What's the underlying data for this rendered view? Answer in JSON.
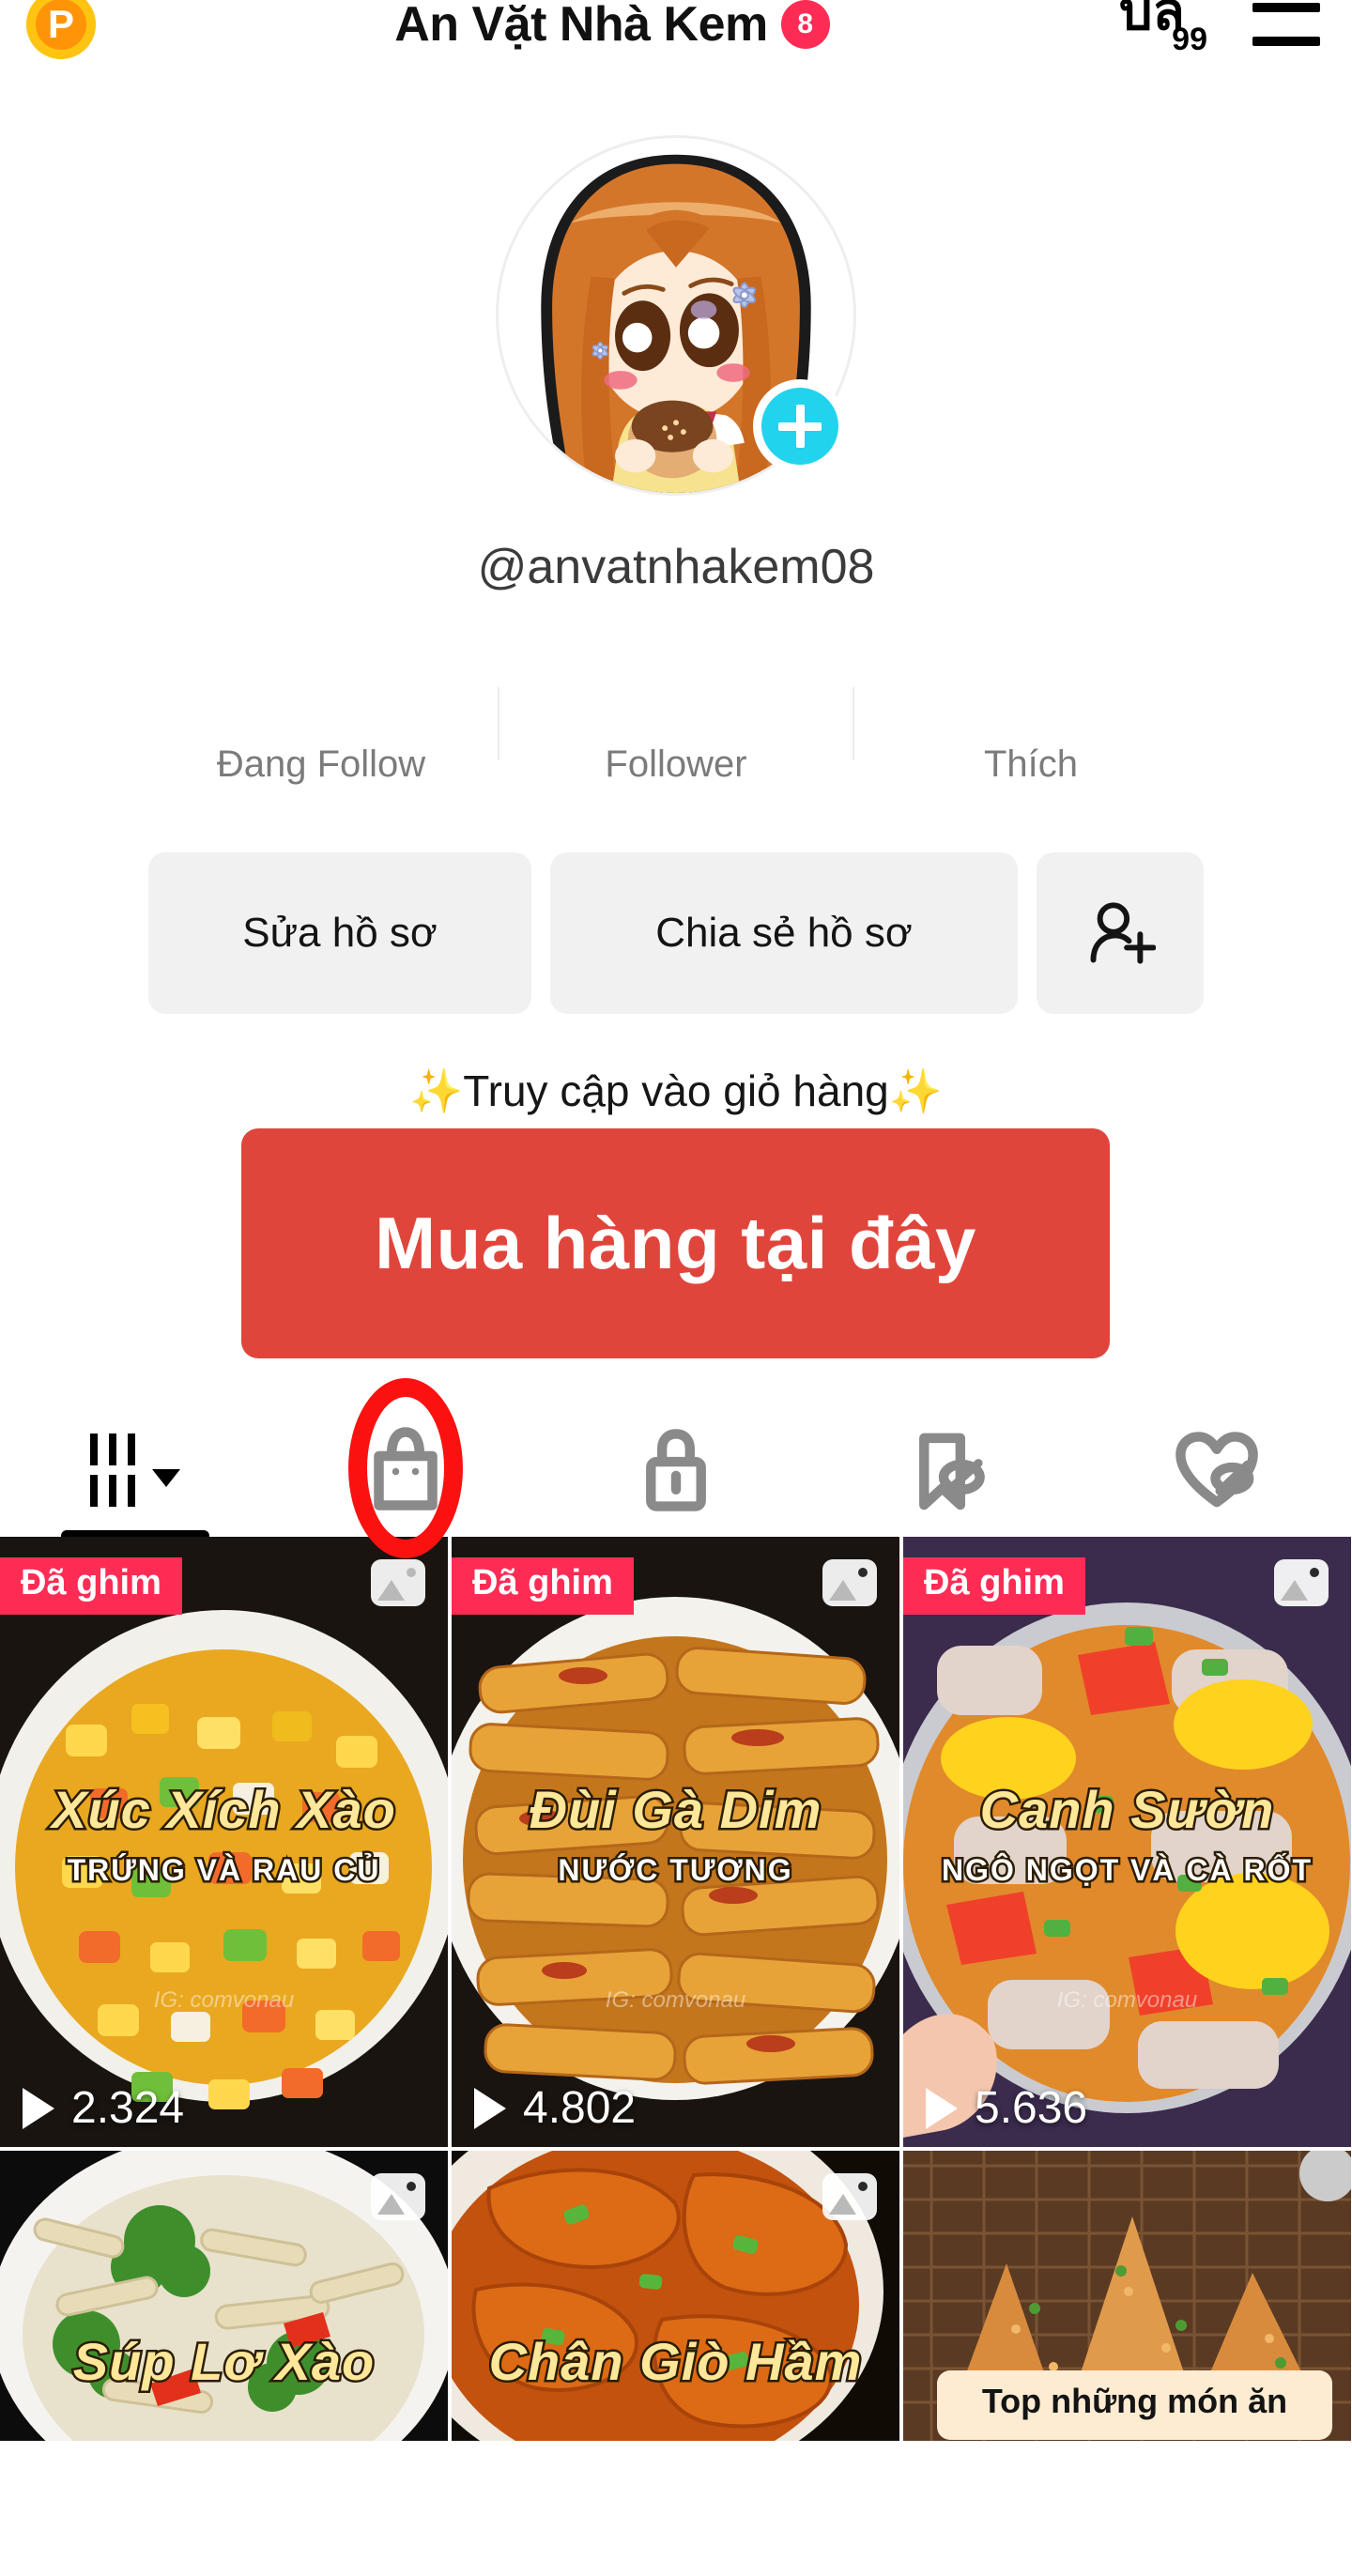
{
  "header": {
    "coin_icon": "coin-p-icon",
    "coin_letter": "P",
    "title": "An Vặt Nhà Kem",
    "title_badge": "8",
    "ads_icon": "ads-manager-icon",
    "ads_glyph": "บล",
    "ads_count": "99",
    "menu_icon": "hamburger-menu-icon"
  },
  "profile": {
    "avatar_alt": "chibi-girl-avatar",
    "follow_button_icon": "plus-icon",
    "handle": "@anvatnhakem08"
  },
  "stats": [
    {
      "value": "",
      "label": "Đang Follow",
      "name": "following"
    },
    {
      "value": "",
      "label": "Follower",
      "name": "followers"
    },
    {
      "value": "",
      "label": "Thích",
      "name": "likes"
    }
  ],
  "actions": {
    "edit_profile": "Sửa hồ sơ",
    "share_profile": "Chia sẻ hồ sơ",
    "add_user_icon": "add-user-icon"
  },
  "bio": {
    "sparkle_left": "✨",
    "text": "Truy cập vào giỏ hàng",
    "sparkle_right": "✨"
  },
  "cta": {
    "label": "Mua hàng tại đây",
    "color": "#e0453c"
  },
  "tabs": [
    {
      "name": "tab-videos",
      "icon": "grid-icon",
      "active": true,
      "has_caret": true
    },
    {
      "name": "tab-shop",
      "icon": "shopping-bag-icon",
      "active": false,
      "highlighted": true
    },
    {
      "name": "tab-private",
      "icon": "lock-icon",
      "active": false
    },
    {
      "name": "tab-saved",
      "icon": "bookmark-hidden-icon",
      "active": false
    },
    {
      "name": "tab-liked",
      "icon": "heart-hidden-icon",
      "active": false
    }
  ],
  "annotation": {
    "shape": "red-oval-highlight",
    "color": "#fc1111",
    "target": "tab-shop"
  },
  "videos": [
    {
      "pin_label": "Đã ghim",
      "multi_icon": "multiple-photos-icon",
      "views": "2.324",
      "overlay_title": "Xúc Xích Xào",
      "overlay_sub": "TRỨNG VÀ RAU CỦ",
      "watermark": "IG: comvonau"
    },
    {
      "pin_label": "Đã ghim",
      "multi_icon": "multiple-photos-icon",
      "views": "4.802",
      "overlay_title": "Đùi Gà Dim",
      "overlay_sub": "NƯỚC TƯƠNG",
      "watermark": "IG: comvonau"
    },
    {
      "pin_label": "Đã ghim",
      "multi_icon": "multiple-photos-icon",
      "views": "5.636",
      "overlay_title": "Canh Sườn",
      "overlay_sub": "NGÔ NGỌT VÀ CÀ RỐT",
      "watermark": "IG: comvonau"
    },
    {
      "pin_label": "",
      "multi_icon": "multiple-photos-icon",
      "views": "",
      "overlay_title": "Súp Lơ Xào",
      "overlay_sub": "",
      "watermark": ""
    },
    {
      "pin_label": "",
      "multi_icon": "multiple-photos-icon",
      "views": "",
      "overlay_title": "Chân Giò Hầm",
      "overlay_sub": "",
      "watermark": ""
    },
    {
      "pin_label": "",
      "multi_icon": "",
      "views": "",
      "overlay_title": "",
      "overlay_sub": "",
      "banner": "Top những món ăn",
      "watermark": ""
    }
  ]
}
